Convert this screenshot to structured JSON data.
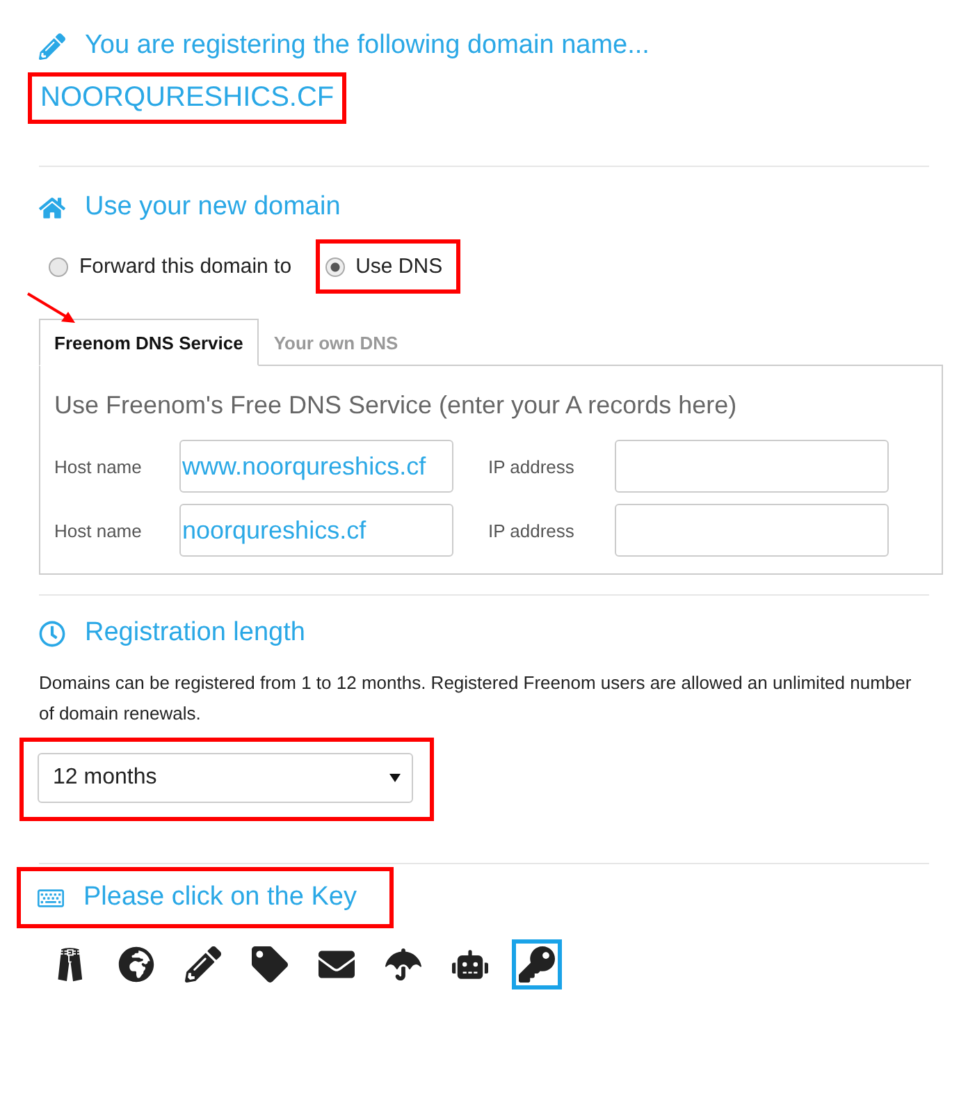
{
  "registering": {
    "heading": "You are registering the following domain name...",
    "domain": "NOORQURESHICS.CF",
    "highlighted": true
  },
  "use_domain": {
    "heading": "Use your new domain",
    "options": [
      {
        "label": "Forward this domain to",
        "selected": false,
        "highlighted": false
      },
      {
        "label": "Use DNS",
        "selected": true,
        "highlighted": true
      }
    ]
  },
  "tabs": [
    {
      "label": "Freenom DNS Service",
      "selected": true,
      "arrow": true
    },
    {
      "label": "Your own DNS",
      "selected": false,
      "arrow": false
    }
  ],
  "dns_panel": {
    "title": "Use Freenom's Free DNS Service (enter your A records here)",
    "rows": [
      {
        "host_label": "Host name",
        "host_value": "www.noorqureshics.cf",
        "ip_label": "IP address"
      },
      {
        "host_label": "Host name",
        "host_value": "noorqureshics.cf",
        "ip_label": "IP address"
      }
    ]
  },
  "registration": {
    "heading": "Registration length",
    "description": "Domains can be registered from 1 to 12 months. Registered Freenom users are allowed an unlimited number of domain renewals.",
    "period": "12 months",
    "highlighted": true
  },
  "captcha": {
    "heading": "Please click on the Key",
    "highlighted": true,
    "icons": [
      {
        "kind": "pants",
        "selected": false
      },
      {
        "kind": "globe",
        "selected": false
      },
      {
        "kind": "pencil",
        "selected": false
      },
      {
        "kind": "tag",
        "selected": false
      },
      {
        "kind": "envelope",
        "selected": false
      },
      {
        "kind": "umbrella",
        "selected": false
      },
      {
        "kind": "robot",
        "selected": false
      },
      {
        "kind": "key",
        "selected": true
      }
    ]
  }
}
